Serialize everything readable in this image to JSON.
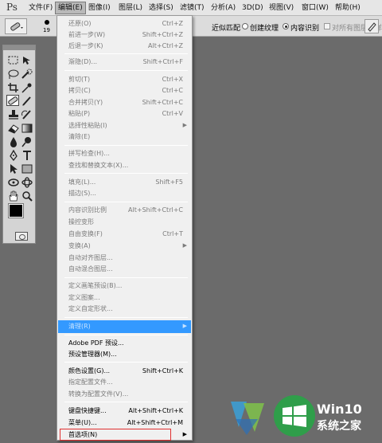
{
  "app": {
    "logo": "Ps"
  },
  "menubar": {
    "items": [
      {
        "label": "文件(F)"
      },
      {
        "label": "编辑(E)"
      },
      {
        "label": "图像(I)"
      },
      {
        "label": "图层(L)"
      },
      {
        "label": "选择(S)"
      },
      {
        "label": "滤镜(T)"
      },
      {
        "label": "分析(A)"
      },
      {
        "label": "3D(D)"
      },
      {
        "label": "视图(V)"
      },
      {
        "label": "窗口(W)"
      },
      {
        "label": "帮助(H)"
      }
    ],
    "active": "编辑(E)"
  },
  "options": {
    "brush_size": "19",
    "proximity_match": "近似匹配",
    "create_texture": "创建纹理",
    "content_aware": "内容识别",
    "sample_all_layers": "对所有图层取样",
    "selected_mode": "内容识别"
  },
  "tools": {
    "selected": "spot-healing-brush",
    "names": [
      "marquee",
      "move",
      "lasso",
      "quick-selection",
      "crop",
      "eyedropper",
      "spot-healing-brush",
      "brush",
      "clone-stamp",
      "history-brush",
      "eraser",
      "gradient",
      "blur",
      "dodge",
      "pen",
      "type",
      "path-selection",
      "rectangle",
      "3d-rotate",
      "3d-orbit",
      "hand",
      "zoom"
    ],
    "foreground_color": "#000000",
    "background_color": "#ffffff"
  },
  "edit_menu": {
    "items": [
      {
        "label": "还原(O)",
        "shortcut": "Ctrl+Z",
        "state": "disabled"
      },
      {
        "label": "前进一步(W)",
        "shortcut": "Shift+Ctrl+Z",
        "state": "disabled"
      },
      {
        "label": "后退一步(K)",
        "shortcut": "Alt+Ctrl+Z",
        "state": "disabled"
      },
      {
        "label": "渐隐(D)...",
        "shortcut": "Shift+Ctrl+F",
        "state": "disabled"
      },
      {
        "label": "剪切(T)",
        "shortcut": "Ctrl+X",
        "state": "disabled"
      },
      {
        "label": "拷贝(C)",
        "shortcut": "Ctrl+C",
        "state": "disabled"
      },
      {
        "label": "合并拷贝(Y)",
        "shortcut": "Shift+Ctrl+C",
        "state": "disabled"
      },
      {
        "label": "粘贴(P)",
        "shortcut": "Ctrl+V",
        "state": "disabled"
      },
      {
        "label": "选择性粘贴(I)",
        "shortcut": "",
        "state": "disabled",
        "submenu": true
      },
      {
        "label": "清除(E)",
        "shortcut": "",
        "state": "disabled"
      },
      {
        "label": "拼写检查(H)...",
        "shortcut": "",
        "state": "disabled"
      },
      {
        "label": "查找和替换文本(X)...",
        "shortcut": "",
        "state": "disabled"
      },
      {
        "label": "填充(L)...",
        "shortcut": "Shift+F5",
        "state": "disabled"
      },
      {
        "label": "描边(S)...",
        "shortcut": "",
        "state": "disabled"
      },
      {
        "label": "内容识别比例",
        "shortcut": "Alt+Shift+Ctrl+C",
        "state": "disabled"
      },
      {
        "label": "操控变形",
        "shortcut": "",
        "state": "disabled"
      },
      {
        "label": "自由变换(F)",
        "shortcut": "Ctrl+T",
        "state": "disabled"
      },
      {
        "label": "变换(A)",
        "shortcut": "",
        "state": "disabled",
        "submenu": true
      },
      {
        "label": "自动对齐图层...",
        "shortcut": "",
        "state": "disabled"
      },
      {
        "label": "自动混合图层...",
        "shortcut": "",
        "state": "disabled"
      },
      {
        "label": "定义画笔预设(B)...",
        "shortcut": "",
        "state": "disabled"
      },
      {
        "label": "定义图案...",
        "shortcut": "",
        "state": "disabled"
      },
      {
        "label": "定义自定形状...",
        "shortcut": "",
        "state": "disabled"
      },
      {
        "label": "清理(R)",
        "shortcut": "",
        "state": "highlight",
        "submenu": true
      },
      {
        "label": "Adobe PDF 预设...",
        "shortcut": "",
        "state": "enabled"
      },
      {
        "label": "预设管理器(M)...",
        "shortcut": "",
        "state": "enabled"
      },
      {
        "label": "颜色设置(G)...",
        "shortcut": "Shift+Ctrl+K",
        "state": "enabled"
      },
      {
        "label": "指定配置文件...",
        "shortcut": "",
        "state": "disabled"
      },
      {
        "label": "转换为配置文件(V)...",
        "shortcut": "",
        "state": "disabled"
      },
      {
        "label": "键盘快捷键...",
        "shortcut": "Alt+Shift+Ctrl+K",
        "state": "enabled"
      },
      {
        "label": "菜单(U)...",
        "shortcut": "Alt+Shift+Ctrl+M",
        "state": "enabled"
      },
      {
        "label": "首选项(N)",
        "shortcut": "",
        "state": "enabled",
        "submenu": true
      }
    ]
  },
  "watermark": {
    "line1": "Win10",
    "line2": "系统之家"
  }
}
